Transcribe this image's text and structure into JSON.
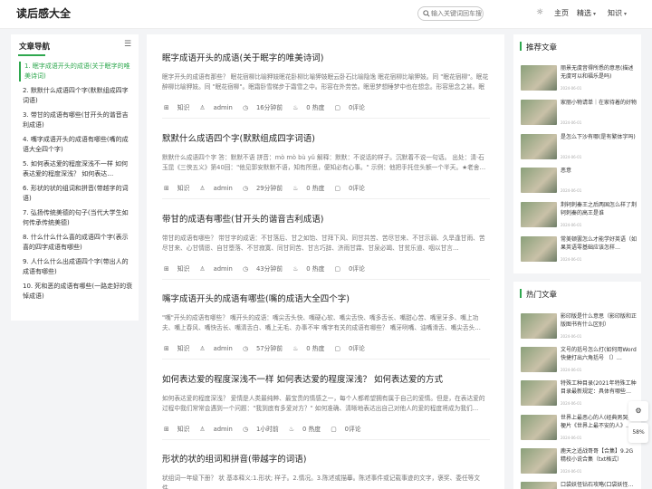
{
  "header": {
    "logo": "读后感大全",
    "search_placeholder": "输入关键词回车搜索",
    "nav": [
      {
        "label": "主页"
      },
      {
        "label": "精选"
      },
      {
        "label": "知识"
      }
    ]
  },
  "toc": {
    "title": "文章导航",
    "items": [
      "1. 眠字成语开头的成语(关于眠字的唯美诗词)",
      "2. 默默什么成语四个字(默默组成四字词语)",
      "3. 带甘的成语有哪些(甘开头的谐音吉利成语)",
      "4. 嘴字成语开头的成语有哪些(嘴的成语大全四个字)",
      "5. 如何表达爱的程度深浅不一样 如何表达爱的程度深浅？ 如何表达…",
      "6. 形状的状的组词和拼音(带越字的词语)",
      "7. 弘扬传统美德的句子(当代大学生如何传承传统美德)",
      "8. 什么什么什么喜的成语四个字(表示喜的四字成语有哪些)",
      "9. 人什么什么出成语四个字(带出人的成语有哪些)",
      "10. 死和恶的成语有哪些(一路走好的衰悼成语)"
    ]
  },
  "articles": [
    {
      "title": "眠字成语开头的成语(关于眠字的唯美诗词)",
      "excerpt": "眠字开头的成语有那些？ 眠花宿柳比喻狎妓眠花卧柳比喻狎妓眠云卧石比喻隐逸 眠花宿柳比喻狎妓。同 \"眠花宿柳\"。眠花醉柳比喻狎妓。同 \"眠花宿柳\"。眠霜卧雪梯步于霜雪之中。形容在外劳苦。眠思梦想睡梦中也在想念。形容思念之甚。眠云卧石…",
      "category": "知识",
      "author": "admin",
      "time": "16分钟前",
      "heat": "0 热度",
      "comments": "0评论"
    },
    {
      "title": "默默什么成语四个字(默默组成四字词语)",
      "excerpt": "默默什么成语四个字 答：默默不语 拼音：mò mò bù yǔ 解释：默默：不说话的样子。沉默着不说一句话。 出处：清·石玉昆《三侠五义》第40回：\"他见郭安默默不语，知有所思，便知必有心事。\" 示例：他把手托住头额一个半天。★老舍…",
      "category": "知识",
      "author": "admin",
      "time": "29分钟前",
      "heat": "0 热度",
      "comments": "0评论"
    },
    {
      "title": "带甘的成语有哪些(甘开头的谐音吉利成语)",
      "excerpt": "带甘的成语有哪些？ 带甘字的成语：不甘落后、甘之如饴、甘拜下风、同甘共苦、苦尽甘来、不甘示弱、久旱逢甘雨、苦尽甘来、心甘情愿、自甘堕落、不甘寂寞、同甘同苦、甘言巧辞、济雨甘霖、甘泉必竭、甘贫乐道、咽以甘言…",
      "category": "知识",
      "author": "admin",
      "time": "43分钟前",
      "heat": "0 热度",
      "comments": "0评论"
    },
    {
      "title": "嘴字成语开头的成语有哪些(嘴的成语大全四个字)",
      "excerpt": "\"嘴\"开头的成语有哪些？ 嘴开头的成语：嘴尖舌头快、嘴硬心软、嘴尖舌快、嘴多舌长、嘴甜心苦、嘴里牙多、嘴上功夫、嘴上春风、嘴快舌长、嘴清舌白、嘴上无毛、办事不牢 嘴字有关的成语有哪些？ 嘴牙咧嘴、油嘴滑舌、嘴尖舌头…",
      "category": "知识",
      "author": "admin",
      "time": "57分钟前",
      "heat": "0 热度",
      "comments": "0评论"
    },
    {
      "title": "如何表达爱的程度深浅不一样 如何表达爱的程度深浅？ 如何表达爱的方式",
      "excerpt": "如何表达爱的程度深浅？ 爱情是人类最纯粹、最宝贵的情感之一，每个人都希望拥有属于自己的爱情。但是，在表达爱的过程中我们常常会遇到一个问题：\"我到底有多爱对方？\" 如何准确、清晰地表达出自己对他人的爱的程度将成为我们…",
      "category": "知识",
      "author": "admin",
      "time": "1小时前",
      "heat": "0 热度",
      "comments": "0评论"
    },
    {
      "title": "形状的状的组词和拼音(带越字的词语)",
      "excerpt": "状组词一年级下册？ 状 基本释义:1.形状; 样子。2.情况。3.陈述或描摹。陈述事件或记载事迹的文字，褒奖、委任等文件…",
      "category": "知识",
      "author": "admin",
      "time": "",
      "heat": "",
      "comments": ""
    }
  ],
  "recommended": {
    "title": "推荐文章",
    "items": [
      {
        "title": "丽景无虞音得所悉的意思(描述无虞可以和福乐是吗)",
        "date": "2024-06-01"
      },
      {
        "title": "家丽小物请单｜在家待着的好物",
        "date": "2024-06-01"
      },
      {
        "title": "是怎么下沙有哪(是有繁体字吗)",
        "date": "2024-06-01"
      },
      {
        "title": "恶意",
        "date": "2024-06-01"
      },
      {
        "title": "荆轲刺秦王之后两国怎么样了荆轲刺秦的高王是谁",
        "date": "2024-06-01"
      },
      {
        "title": "常美顿罢怎么才能学好英语（如果英语零基础应该怎样…",
        "date": "2024-06-01"
      }
    ]
  },
  "hot": {
    "title": "热门文章",
    "items": [
      {
        "title": "影印版是什么意思（影印版和正版图书有什么区别）",
        "date": "2024-06-01"
      },
      {
        "title": "文号的括号怎么打(如何用Word快捷打出六角括号 〔〕…",
        "date": "2024-06-01"
      },
      {
        "title": "特殊工种目录(2021年特殊工种目录最新规定：具体有哪些…",
        "date": "2024-06-01"
      },
      {
        "title": "世界上最恶心的人(经典男哭哭梗片《世界上最不安的人》…",
        "date": "2024-06-01"
      },
      {
        "title": "鹿天之适战哥哥【合集】9.2G精校小说合集（txt格式）",
        "date": "2024-06-01"
      },
      {
        "title": "口袋妖怪钻石攻略(口袋妖怪…",
        "date": ""
      }
    ]
  },
  "float_buttons": {
    "settings": "⚙",
    "progress": "58%"
  },
  "colors": {
    "accent": "#2fa84f",
    "background": "#f3f4f6"
  }
}
